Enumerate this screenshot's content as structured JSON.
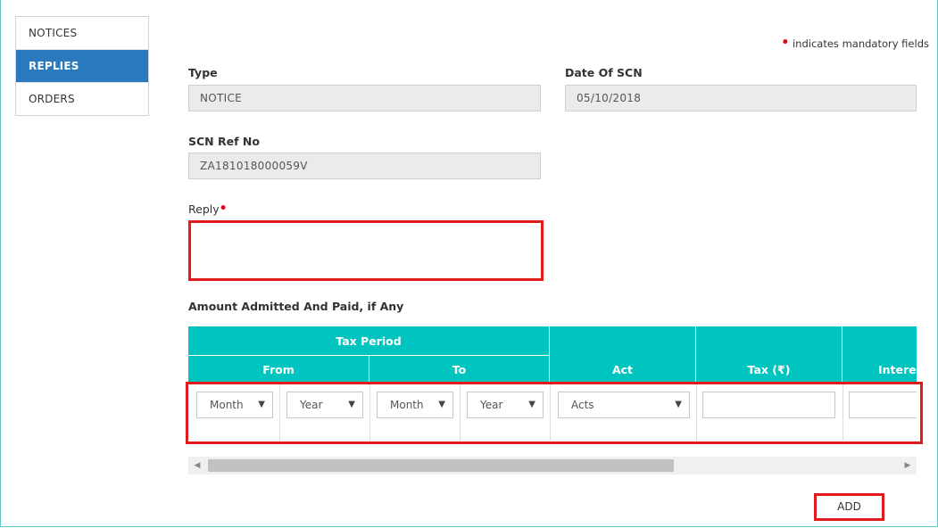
{
  "sidebar": {
    "items": [
      {
        "label": "NOTICES",
        "active": false
      },
      {
        "label": "REPLIES",
        "active": true
      },
      {
        "label": "ORDERS",
        "active": false
      }
    ]
  },
  "mandatory_note": "indicates mandatory fields",
  "form": {
    "type_label": "Type",
    "type_value": "NOTICE",
    "date_label": "Date Of SCN",
    "date_value": "05/10/2018",
    "scn_label": "SCN Ref No",
    "scn_value": "ZA181018000059V",
    "reply_label": "Reply",
    "reply_value": ""
  },
  "amount_section": {
    "title": "Amount Admitted And Paid, if Any",
    "headers": {
      "tax_period": "Tax Period",
      "from": "From",
      "to": "To",
      "act": "Act",
      "tax": "Tax (₹)",
      "interest": "Intere"
    },
    "row": {
      "from_month": "Month",
      "from_year": "Year",
      "to_month": "Month",
      "to_year": "Year",
      "act": "Acts"
    }
  },
  "add_button": "ADD",
  "colors": {
    "header_teal": "#00c4c0",
    "active_blue": "#2a7abf",
    "highlight_red": "#e01b1b",
    "required_red": "#e8001c"
  }
}
